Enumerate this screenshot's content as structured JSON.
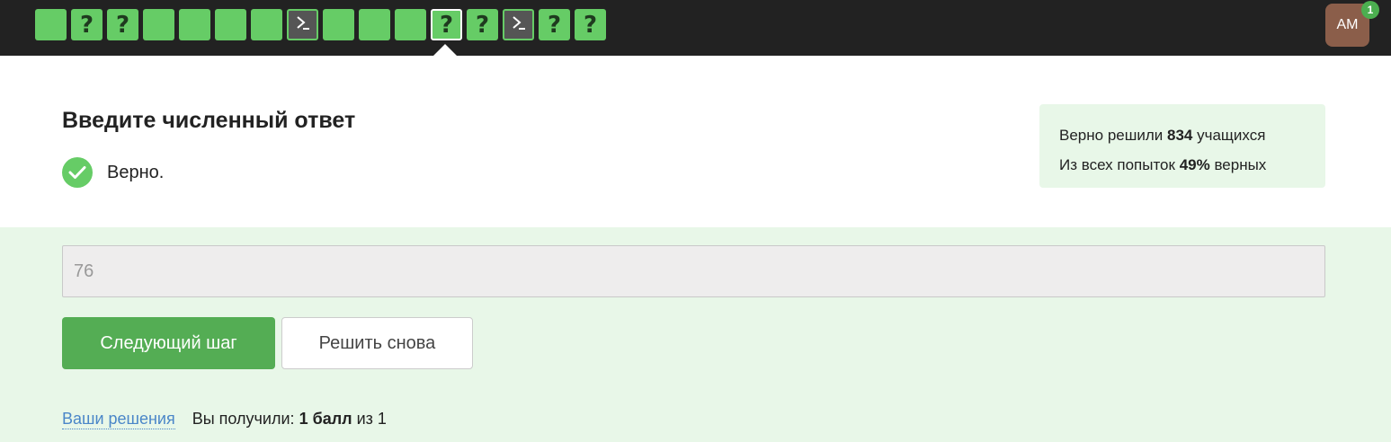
{
  "steps": [
    {
      "type": "text",
      "label": ""
    },
    {
      "type": "quiz",
      "label": "?"
    },
    {
      "type": "quiz",
      "label": "?"
    },
    {
      "type": "text",
      "label": ""
    },
    {
      "type": "text",
      "label": ""
    },
    {
      "type": "text",
      "label": ""
    },
    {
      "type": "text",
      "label": ""
    },
    {
      "type": "code",
      "label": ""
    },
    {
      "type": "text",
      "label": ""
    },
    {
      "type": "text",
      "label": ""
    },
    {
      "type": "text",
      "label": ""
    },
    {
      "type": "quiz",
      "label": "?",
      "active": true
    },
    {
      "type": "quiz",
      "label": "?"
    },
    {
      "type": "code",
      "label": ""
    },
    {
      "type": "quiz",
      "label": "?"
    },
    {
      "type": "quiz",
      "label": "?"
    }
  ],
  "user": {
    "initials": "AM",
    "notifications": "1"
  },
  "task": {
    "title": "Введите численный ответ",
    "verdict": "Верно."
  },
  "stats": {
    "solved_prefix": "Верно решили",
    "solved_count": "834",
    "solved_suffix": "учащихся",
    "attempts_prefix": "Из всех попыток",
    "attempts_percent": "49%",
    "attempts_suffix": "верных"
  },
  "answer": {
    "value": "76"
  },
  "buttons": {
    "next": "Следующий шаг",
    "retry": "Решить снова"
  },
  "footer": {
    "solutions_link": "Ваши решения",
    "score_prefix": "Вы получили:",
    "score_value": "1 балл",
    "score_suffix": "из 1"
  },
  "colors": {
    "success": "#66cc66",
    "topbar": "#222222",
    "answer_bg": "#e8f7e8",
    "link": "#4a86c8"
  }
}
